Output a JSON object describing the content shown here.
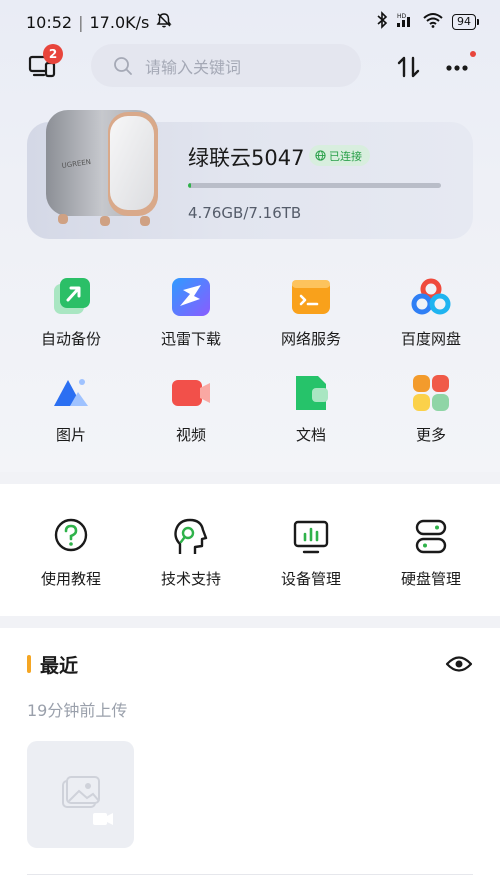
{
  "status_bar": {
    "time": "10:52",
    "network_speed": "17.0K/s",
    "battery": "94"
  },
  "header": {
    "devices_badge": "2",
    "search_placeholder": "请输入关键词"
  },
  "device": {
    "name": "绿联云5047",
    "status": "已连接",
    "brand_label": "UGREEN",
    "storage_text": "4.76GB/7.16TB",
    "storage_fraction": 0.0007
  },
  "features": [
    {
      "label": "自动备份",
      "icon": "auto-backup-icon"
    },
    {
      "label": "迅雷下载",
      "icon": "xunlei-download-icon"
    },
    {
      "label": "网络服务",
      "icon": "network-service-icon"
    },
    {
      "label": "百度网盘",
      "icon": "baidu-netdisk-icon"
    },
    {
      "label": "图片",
      "icon": "photos-icon"
    },
    {
      "label": "视频",
      "icon": "video-icon"
    },
    {
      "label": "文档",
      "icon": "documents-icon"
    },
    {
      "label": "更多",
      "icon": "more-apps-icon"
    }
  ],
  "support": [
    {
      "label": "使用教程",
      "icon": "tutorial-icon"
    },
    {
      "label": "技术支持",
      "icon": "tech-support-icon"
    },
    {
      "label": "设备管理",
      "icon": "device-manage-icon"
    },
    {
      "label": "硬盘管理",
      "icon": "disk-manage-icon"
    }
  ],
  "recent": {
    "title": "最近",
    "subtitle": "19分钟前上传"
  },
  "colors": {
    "accent_green": "#2fb24a",
    "badge_red": "#e8453c",
    "recent_bar": "#f5a623"
  }
}
